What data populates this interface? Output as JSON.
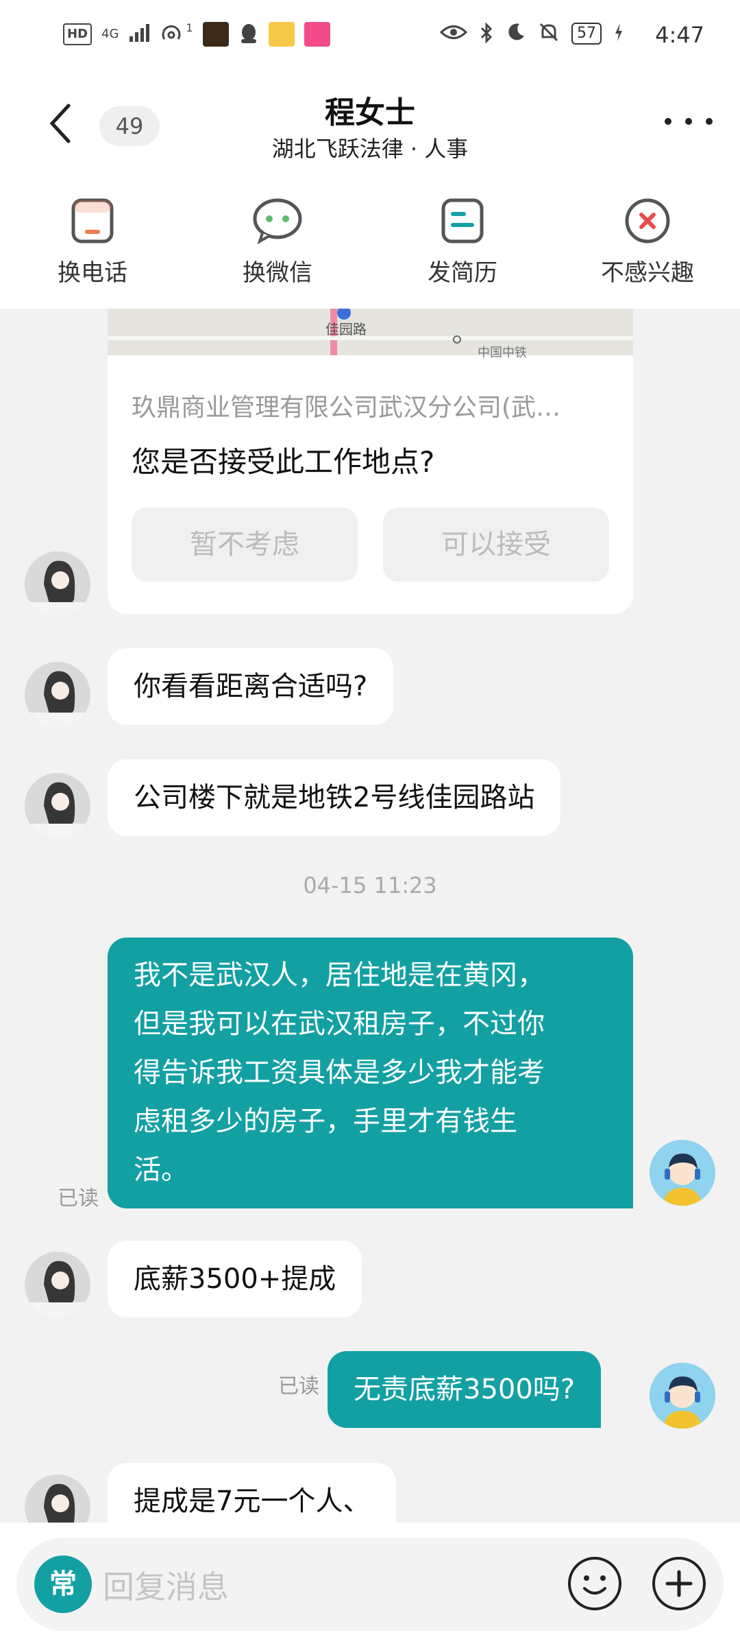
{
  "status_bar": {
    "left_text": "HD",
    "network": "4G",
    "signal_sup": "1",
    "battery": "57",
    "time": "4:47"
  },
  "header": {
    "unread_count": "49",
    "title": "程女士",
    "subtitle": "湖北飞跃法律 · 人事"
  },
  "actions": [
    {
      "label": "换电话",
      "icon": "phone-icon",
      "color": "#f17a4f"
    },
    {
      "label": "换微信",
      "icon": "wechat-icon",
      "color": "#5bbf6a"
    },
    {
      "label": "发简历",
      "icon": "resume-icon",
      "color": "#13a0a3"
    },
    {
      "label": "不感兴趣",
      "icon": "close-circle-icon",
      "color": "#e84d4d"
    }
  ],
  "location_card": {
    "map_labels": [
      "佳园路",
      "中国中铁"
    ],
    "company": "玖鼎商业管理有限公司武汉分公司(武…",
    "question": "您是否接受此工作地点?",
    "decline": "暂不考虑",
    "accept": "可以接受"
  },
  "messages": {
    "m1": "你看看距离合适吗?",
    "m2": "公司楼下就是地铁2号线佳园路站",
    "time_sep": "04-15 11:23",
    "m3_lines": [
      "我不是武汉人，居住地是在黄冈，",
      "但是我可以在武汉租房子，不过你",
      "得告诉我工资具体是多少我才能考",
      "虑租多少的房子，手里才有钱生",
      "活。"
    ],
    "m3_read": "已读",
    "m4": "底薪3500+提成",
    "m5": "无责底薪3500吗?",
    "m5_read": "已读",
    "m6": "提成是7元一个人、"
  },
  "input": {
    "chang": "常",
    "placeholder": "回复消息"
  },
  "colors": {
    "accent": "#13a0a3",
    "background": "#f2f2f2"
  }
}
